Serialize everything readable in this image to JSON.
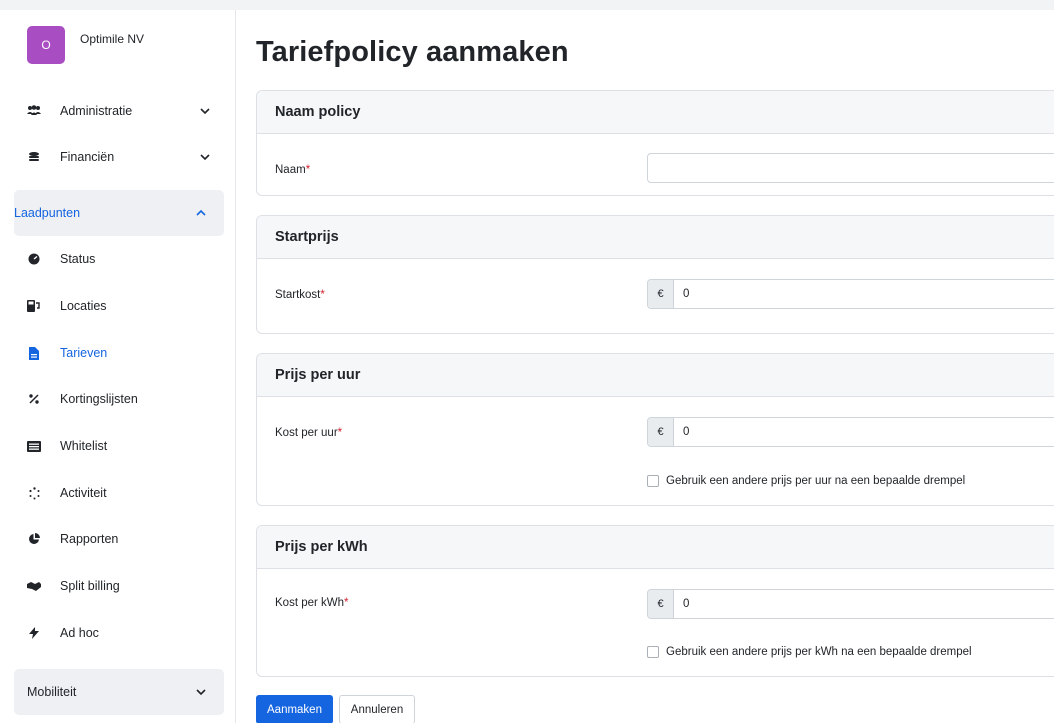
{
  "org": {
    "initial": "O",
    "name": "Optimile NV",
    "color": "#a94dc2"
  },
  "sidebar": {
    "items": [
      {
        "label": "Administratie",
        "icon": "users-icon"
      },
      {
        "label": "Financiën",
        "icon": "coins-icon"
      },
      {
        "label": "Laadpunten",
        "icon": "chevron-up-icon"
      },
      {
        "label": "Status",
        "icon": "gauge-icon"
      },
      {
        "label": "Locaties",
        "icon": "charging-station-icon"
      },
      {
        "label": "Tarieven",
        "icon": "file-icon"
      },
      {
        "label": "Kortingslijsten",
        "icon": "percent-icon"
      },
      {
        "label": "Whitelist",
        "icon": "list-icon"
      },
      {
        "label": "Activiteit",
        "icon": "spinner-icon"
      },
      {
        "label": "Rapporten",
        "icon": "pie-chart-icon"
      },
      {
        "label": "Split billing",
        "icon": "handshake-icon"
      },
      {
        "label": "Ad hoc",
        "icon": "bolt-icon"
      },
      {
        "label": "Mobiliteit",
        "icon": "chevron-down-icon"
      }
    ]
  },
  "page": {
    "title": "Tariefpolicy aanmaken"
  },
  "sections": {
    "naam": {
      "header": "Naam policy",
      "label": "Naam",
      "required": "*",
      "value": ""
    },
    "start": {
      "header": "Startprijs",
      "label": "Startkost",
      "required": "*",
      "currency": "€",
      "value": "0"
    },
    "uur": {
      "header": "Prijs per uur",
      "label": "Kost per uur",
      "required": "*",
      "currency": "€",
      "value": "0",
      "checkbox": "Gebruik een andere prijs per uur na een bepaalde drempel"
    },
    "kwh": {
      "header": "Prijs per kWh",
      "label": "Kost per kWh",
      "required": "*",
      "currency": "€",
      "value": "0",
      "checkbox": "Gebruik een andere prijs per kWh na een bepaalde drempel"
    }
  },
  "buttons": {
    "create": "Aanmaken",
    "cancel": "Annuleren"
  },
  "colors": {
    "primary": "#1565e0",
    "required": "#d0202f",
    "active_bg": "#eef0f4"
  }
}
